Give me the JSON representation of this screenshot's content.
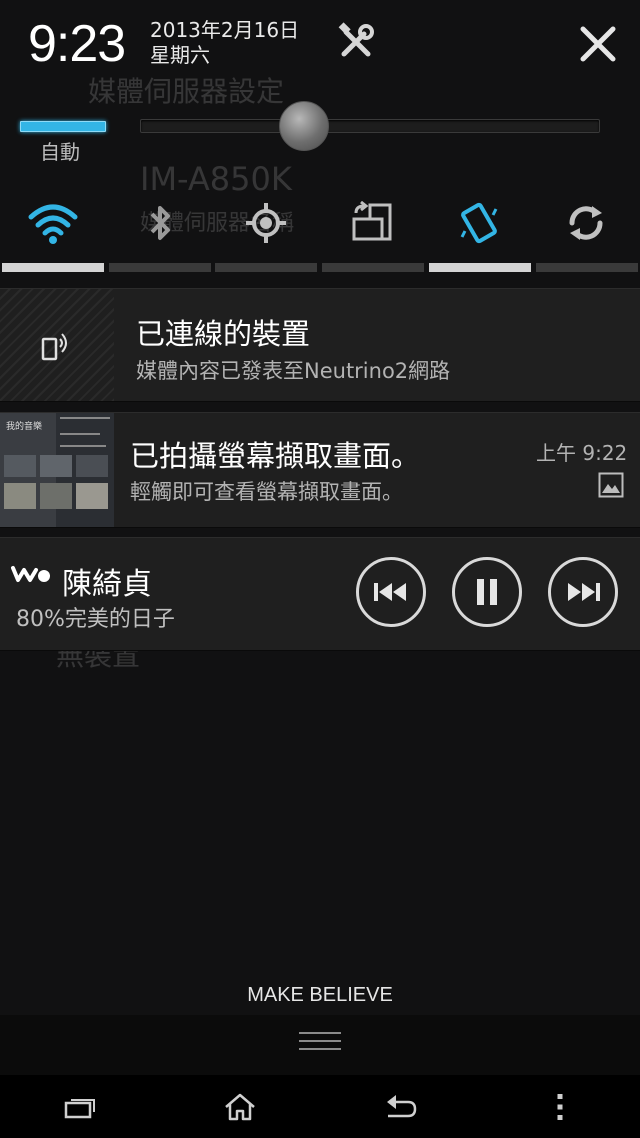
{
  "background_app": {
    "title": "媒體伺服器設定",
    "model": "IM-A850K",
    "subtitle": "媒體伺服器名稱",
    "bottom_text": "無裝置"
  },
  "header": {
    "time": "9:23",
    "date": "2013年2月16日",
    "weekday": "星期六",
    "settings_icon": "tools-icon",
    "close_icon": "close-icon"
  },
  "brightness": {
    "auto_label": "自動",
    "auto_on": true,
    "level": 0.34
  },
  "quick_toggles": [
    {
      "name": "wifi",
      "icon": "wifi-icon",
      "on": true
    },
    {
      "name": "bluetooth",
      "icon": "bluetooth-icon",
      "on": false
    },
    {
      "name": "gps",
      "icon": "gps-icon",
      "on": false
    },
    {
      "name": "auto-rotate",
      "icon": "rotate-icon",
      "on": false
    },
    {
      "name": "vibrate",
      "icon": "vibrate-icon",
      "on": true
    },
    {
      "name": "sync",
      "icon": "sync-icon",
      "on": false
    }
  ],
  "notifications": [
    {
      "title": "已連線的裝置",
      "text": "媒體內容已發表至Neutrino2網路"
    },
    {
      "title": "已拍攝螢幕擷取畫面。",
      "text": "輕觸即可查看螢幕擷取畫面。",
      "time": "上午 9:22"
    }
  ],
  "thumbnail": {
    "label": "我的音樂"
  },
  "media": {
    "artist": "陳綺貞",
    "song": "80%完美的日子"
  },
  "carrier": "MAKE BELIEVE",
  "colors": {
    "accent": "#33b5e5",
    "panel": "#1f1f1f",
    "background": "#111112"
  }
}
